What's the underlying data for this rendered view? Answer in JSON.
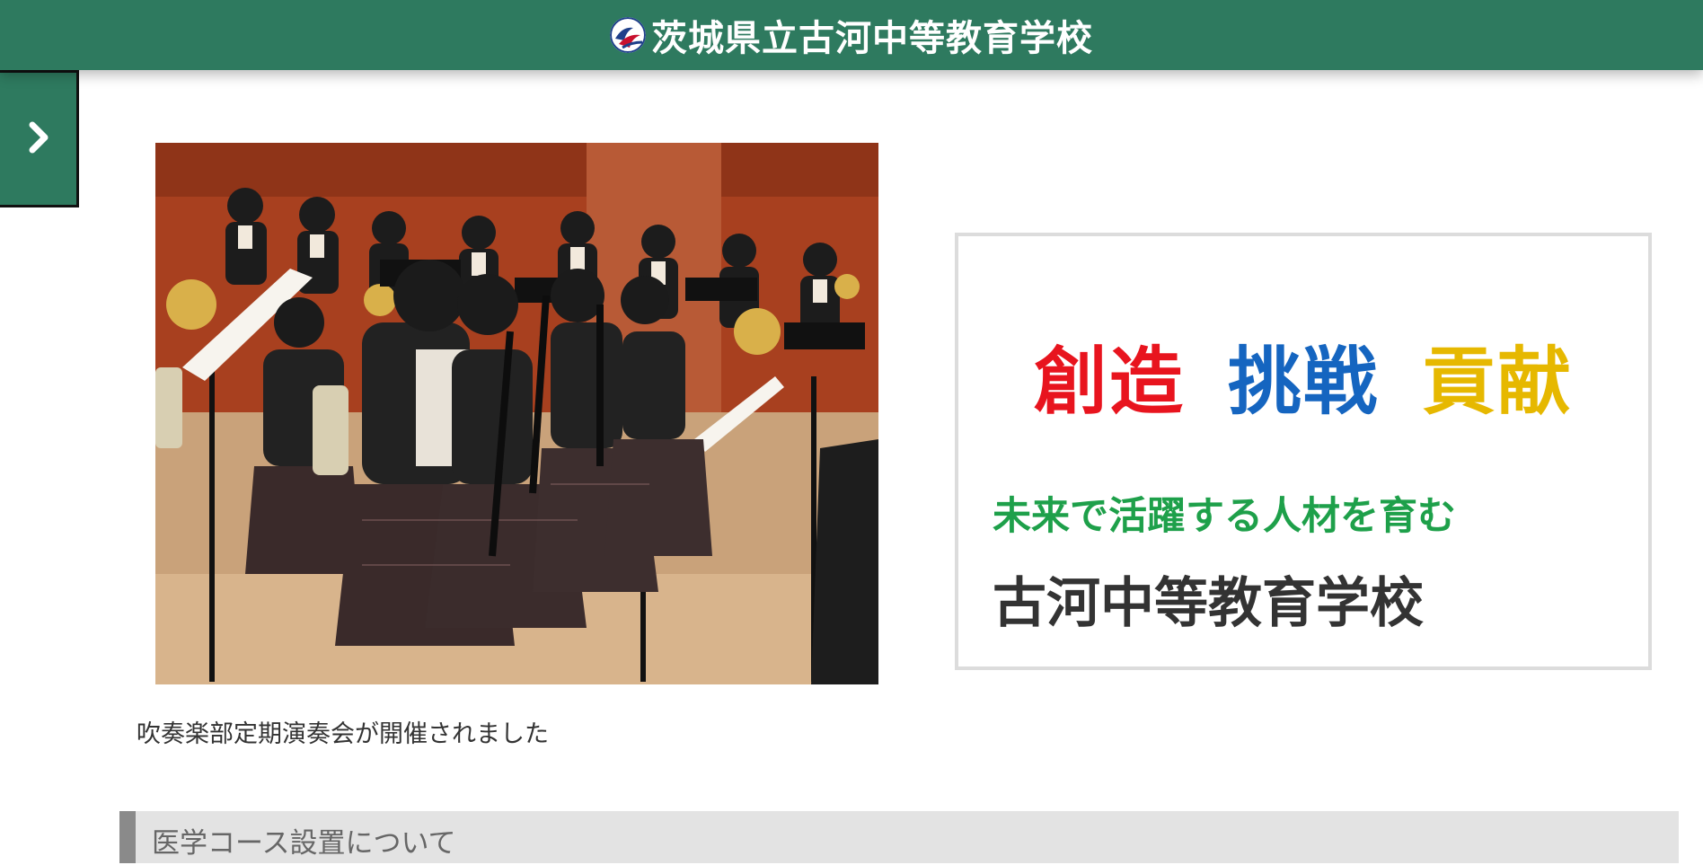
{
  "header": {
    "site_title": "茨城県立古河中等教育学校",
    "logo_icon": "school-emblem-icon"
  },
  "menu": {
    "toggle_icon": "chevron-right-icon"
  },
  "slideshow": {
    "caption": "吹奏楽部定期演奏会が開催されました"
  },
  "motto": {
    "words": [
      {
        "text": "創造",
        "color": "#e8141e"
      },
      {
        "text": "挑戦",
        "color": "#1565c0"
      },
      {
        "text": "貢献",
        "color": "#e6b800"
      }
    ],
    "tagline": "未来で活躍する人材を育む",
    "school_name": "古河中等教育学校"
  },
  "news": {
    "title": "医学コース設置について"
  },
  "colors": {
    "header_bg": "#2e7a5f",
    "tagline": "#1ea04a",
    "news_bar_bg": "#e3e3e3",
    "news_bar_accent": "#8a8a8a"
  }
}
